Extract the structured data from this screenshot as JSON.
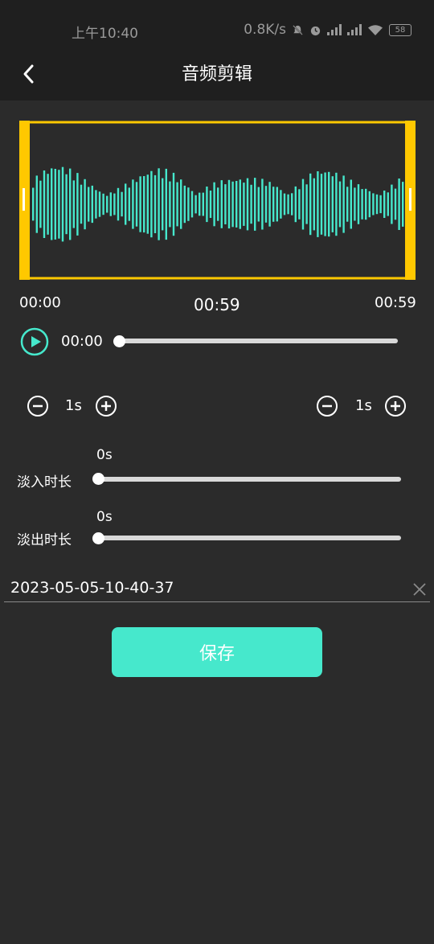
{
  "status_bar": {
    "time": "上午10:40",
    "network_speed": "0.8K/s",
    "battery": "58",
    "icons": [
      "mute-icon",
      "alarm-icon",
      "signal-icon",
      "signal-icon",
      "wifi-icon",
      "battery-icon"
    ]
  },
  "header": {
    "title": "音频剪辑",
    "back_icon": "chevron-left-icon"
  },
  "waveform": {
    "selection_color": "#ffc800",
    "wave_color": "#46e8cc",
    "start_label": "00:00",
    "duration_label": "00:59",
    "end_label": "00:59"
  },
  "player": {
    "play_icon": "play-icon",
    "current_time": "00:00",
    "progress": 0
  },
  "trim_start": {
    "minus_icon": "minus-circle-icon",
    "step": "1s",
    "plus_icon": "plus-circle-icon"
  },
  "trim_end": {
    "minus_icon": "minus-circle-icon",
    "step": "1s",
    "plus_icon": "plus-circle-icon"
  },
  "fade_in": {
    "label": "淡入时长",
    "value": "0s",
    "level": 0
  },
  "fade_out": {
    "label": "淡出时长",
    "value": "0s",
    "level": 0
  },
  "file": {
    "name": "2023-05-05-10-40-37",
    "clear_icon": "close-icon"
  },
  "save_label": "保存",
  "colors": {
    "accent": "#46e8cc",
    "selection": "#ffc800",
    "background": "#2b2b2b",
    "bar": "#1f1f1f"
  }
}
